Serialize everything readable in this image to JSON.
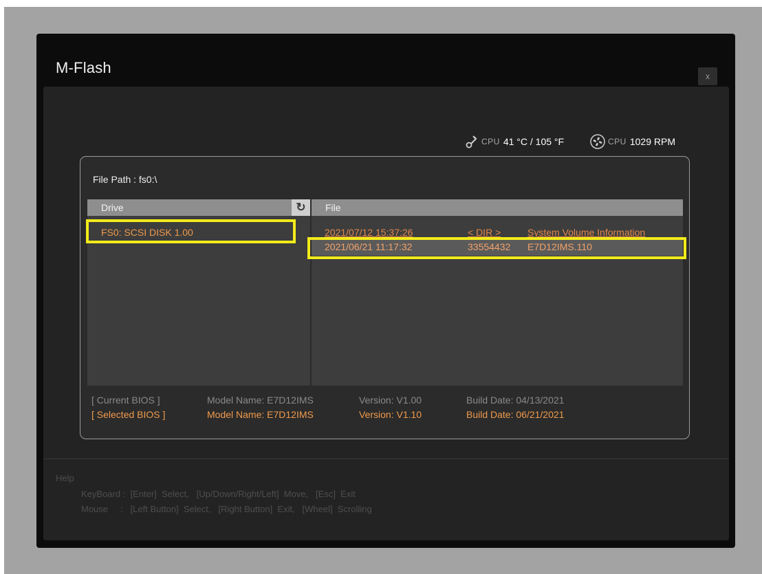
{
  "window": {
    "title": "M-Flash",
    "close_label": "x"
  },
  "status": {
    "cpu_temp_label": "CPU",
    "cpu_temp_value": "41 °C / 105 °F",
    "cpu_fan_label": "CPU",
    "cpu_fan_value": "1029 RPM"
  },
  "file_path": "File Path : fs0:\\",
  "drive_panel": {
    "header": "Drive",
    "refresh_icon": "refresh-icon",
    "items": [
      {
        "label": "FS0: SCSI DISK 1.00"
      }
    ]
  },
  "file_panel": {
    "header": "File",
    "rows": [
      {
        "datetime": "2021/07/12 15:37:26",
        "size": "< DIR >",
        "name": "System Volume Information"
      },
      {
        "datetime": "2021/06/21 11:17:32",
        "size": "33554432",
        "name": "E7D12IMS.110"
      }
    ]
  },
  "bios_info": {
    "current": {
      "label": "[ Current BIOS  ]",
      "model": "Model Name: E7D12IMS",
      "version": "Version: V1.00",
      "build": "Build Date: 04/13/2021"
    },
    "selected": {
      "label": "[ Selected BIOS ]",
      "model": "Model Name: E7D12IMS",
      "version": "Version: V1.10",
      "build": "Build Date: 06/21/2021"
    }
  },
  "help": {
    "title": "Help",
    "keyboard": "KeyBoard :  [Enter]  Select,   [Up/Down/Right/Left]  Move,   [Esc]  Exit",
    "mouse": "Mouse     :   [Left Button]  Select,   [Right Button]  Exit,   [Wheel]  Scrolling"
  },
  "colors": {
    "accent_orange": "#f09a4c",
    "highlight_yellow": "#f2eb1a",
    "panel_bg": "#3d3d3d"
  }
}
